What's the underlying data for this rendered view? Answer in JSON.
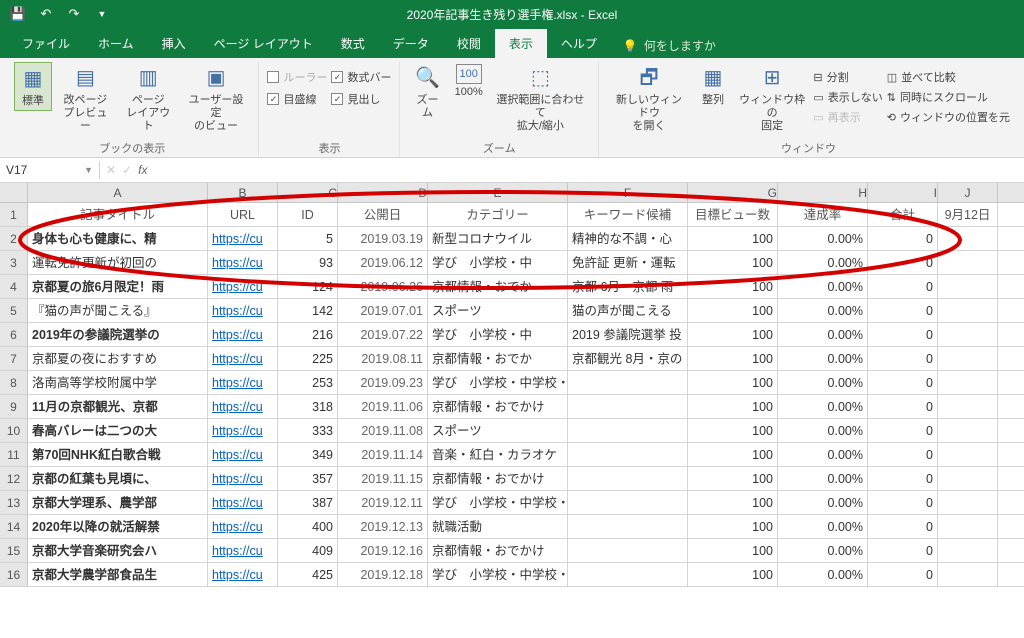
{
  "window": {
    "title": "2020年記事生き残り選手権.xlsx  -  Excel"
  },
  "ribbon_tabs": [
    "ファイル",
    "ホーム",
    "挿入",
    "ページ レイアウト",
    "数式",
    "データ",
    "校閲",
    "表示",
    "ヘルプ"
  ],
  "active_tab": "表示",
  "tell_me": "何をしますか",
  "ribbon": {
    "group_labels": {
      "views": "ブックの表示",
      "show": "表示",
      "zoom": "ズーム",
      "window": "ウィンドウ"
    },
    "views": {
      "normal": "標準",
      "pagebreak": "改ページ\nプレビュー",
      "pagelayout": "ページ\nレイアウト",
      "custom": "ユーザー設定\nのビュー"
    },
    "show": {
      "ruler": "ルーラー",
      "formula_bar": "数式バー",
      "gridlines": "目盛線",
      "headings": "見出し",
      "formula_checked": true,
      "grid_checked": true,
      "headings_checked": true,
      "ruler_checked": false
    },
    "zoom": {
      "zoom": "ズーム",
      "hundred": "100%",
      "fit": "選択範囲に合わせて\n拡大/縮小"
    },
    "window": {
      "new": "新しいウィンドウ\nを開く",
      "arrange": "整列",
      "freeze": "ウィンドウ枠の\n固定",
      "split": "分割",
      "hide": "表示しない",
      "unhide": "再表示",
      "sxs": "並べて比較",
      "sync": "同時にスクロール",
      "reset": "ウィンドウの位置を元"
    }
  },
  "name_box": "V17",
  "columns": [
    "A",
    "B",
    "C",
    "D",
    "E",
    "F",
    "G",
    "H",
    "I",
    "J"
  ],
  "headers": {
    "A": "記事タイトル",
    "B": "URL",
    "C": "ID",
    "D": "公開日",
    "E": "カテゴリー",
    "F": "キーワード候補",
    "G": "目標ビュー数",
    "H": "達成率",
    "I": "合計",
    "J": "9月12日"
  },
  "rows": [
    {
      "n": 2,
      "A": "身体も心も健康に、精",
      "B": "https://cu",
      "C": "5",
      "D": "2019.03.19",
      "E": "新型コロナウイル",
      "F": "精神的な不調・心",
      "G": "100",
      "H": "0.00%",
      "I": "0",
      "bold": true
    },
    {
      "n": 3,
      "A": "運転免許更新が初回の",
      "B": "https://cu",
      "C": "93",
      "D": "2019.06.12",
      "E": "学び　小学校・中",
      "F": "免許証 更新・運転",
      "G": "100",
      "H": "0.00%",
      "I": "0",
      "bold": false
    },
    {
      "n": 4,
      "A": "京都夏の旅6月限定！雨",
      "B": "https://cu",
      "C": "124",
      "D": "2019.06.26",
      "E": "京都情報・おでか",
      "F": "京都 6月・京都 雨",
      "G": "100",
      "H": "0.00%",
      "I": "0",
      "bold": true
    },
    {
      "n": 5,
      "A": "『猫の声が聞こえる』",
      "B": "https://cu",
      "C": "142",
      "D": "2019.07.01",
      "E": "スポーツ",
      "F": "猫の声が聞こえる",
      "G": "100",
      "H": "0.00%",
      "I": "0",
      "bold": false
    },
    {
      "n": 6,
      "A": "2019年の参議院選挙の",
      "B": "https://cu",
      "C": "216",
      "D": "2019.07.22",
      "E": "学び　小学校・中",
      "F": "2019 参議院選挙 投",
      "G": "100",
      "H": "0.00%",
      "I": "0",
      "bold": true
    },
    {
      "n": 7,
      "A": "京都夏の夜におすすめ",
      "B": "https://cu",
      "C": "225",
      "D": "2019.08.11",
      "E": "京都情報・おでか",
      "F": "京都観光 8月・京の",
      "G": "100",
      "H": "0.00%",
      "I": "0",
      "bold": false
    },
    {
      "n": 8,
      "A": "洛南高等学校附属中学",
      "B": "https://cu",
      "C": "253",
      "D": "2019.09.23",
      "E": "学び　小学校・中学校・高校・大学",
      "F": "",
      "G": "100",
      "H": "0.00%",
      "I": "0",
      "bold": false
    },
    {
      "n": 9,
      "A": "11月の京都観光、京都",
      "B": "https://cu",
      "C": "318",
      "D": "2019.11.06",
      "E": "京都情報・おでかけ",
      "F": "",
      "G": "100",
      "H": "0.00%",
      "I": "0",
      "bold": true
    },
    {
      "n": 10,
      "A": "春高バレーは二つの大",
      "B": "https://cu",
      "C": "333",
      "D": "2019.11.08",
      "E": "スポーツ",
      "F": "",
      "G": "100",
      "H": "0.00%",
      "I": "0",
      "bold": true
    },
    {
      "n": 11,
      "A": "第70回NHK紅白歌合戦",
      "B": "https://cu",
      "C": "349",
      "D": "2019.11.14",
      "E": "音楽・紅白・カラオケ",
      "F": "",
      "G": "100",
      "H": "0.00%",
      "I": "0",
      "bold": true
    },
    {
      "n": 12,
      "A": "京都の紅葉も見頃に、",
      "B": "https://cu",
      "C": "357",
      "D": "2019.11.15",
      "E": "京都情報・おでかけ",
      "F": "",
      "G": "100",
      "H": "0.00%",
      "I": "0",
      "bold": true
    },
    {
      "n": 13,
      "A": "京都大学理系、農学部",
      "B": "https://cu",
      "C": "387",
      "D": "2019.12.11",
      "E": "学び　小学校・中学校・高校・大学",
      "F": "",
      "G": "100",
      "H": "0.00%",
      "I": "0",
      "bold": true
    },
    {
      "n": 14,
      "A": "2020年以降の就活解禁",
      "B": "https://cu",
      "C": "400",
      "D": "2019.12.13",
      "E": "就職活動",
      "F": "",
      "G": "100",
      "H": "0.00%",
      "I": "0",
      "bold": true
    },
    {
      "n": 15,
      "A": "京都大学音楽研究会ハ",
      "B": "https://cu",
      "C": "409",
      "D": "2019.12.16",
      "E": "京都情報・おでかけ",
      "F": "",
      "G": "100",
      "H": "0.00%",
      "I": "0",
      "bold": true
    },
    {
      "n": 16,
      "A": "京都大学農学部食品生",
      "B": "https://cu",
      "C": "425",
      "D": "2019.12.18",
      "E": "学び　小学校・中学校・高校・大学",
      "F": "",
      "G": "100",
      "H": "0.00%",
      "I": "0",
      "bold": true
    }
  ],
  "annotation": {
    "type": "oval",
    "color": "#d40000"
  }
}
